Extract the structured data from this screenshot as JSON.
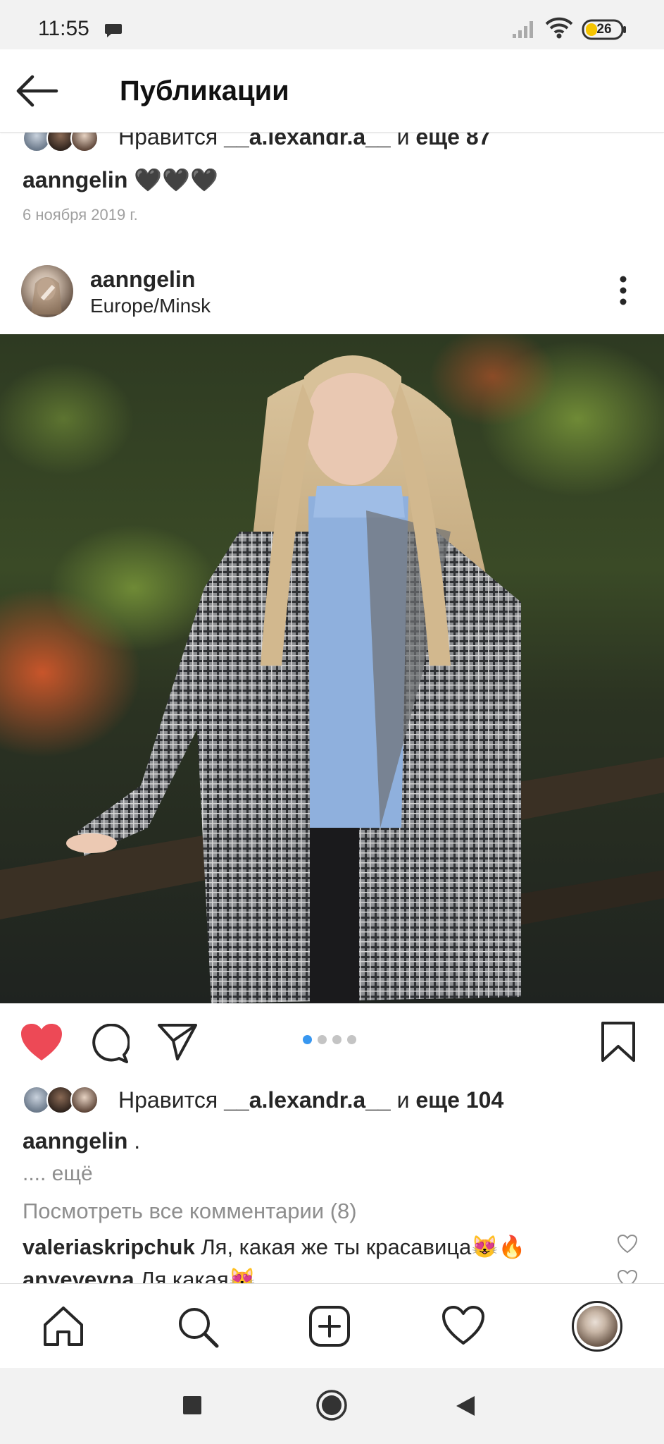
{
  "status_bar": {
    "time": "11:55",
    "battery": "26"
  },
  "header": {
    "title": "Публикации"
  },
  "previous_post": {
    "likes": {
      "prefix": "Нравится",
      "user": "__a.lexandr.a__",
      "middle": "и",
      "rest": "еще 87"
    },
    "caption": {
      "user": "aanngelin",
      "text": "🖤🖤🖤"
    },
    "date": "6 ноября 2019 г."
  },
  "post": {
    "username": "aanngelin",
    "location": "Europe/Minsk",
    "liked": true,
    "carousel": {
      "count": 4,
      "active": 1
    },
    "likes": {
      "prefix": "Нравится",
      "user": "__a.lexandr.a__",
      "middle": "и",
      "rest": "еще 104"
    },
    "caption": {
      "user": "aanngelin",
      "text": "."
    },
    "more": ".... ещё",
    "view_comments": "Посмотреть все комментарии (8)",
    "comments": [
      {
        "user": "valeriaskripchuk",
        "text": "Ля, какая же ты красавица😻🔥"
      },
      {
        "user": "anyeyeyna",
        "text": "Ля какая😻"
      }
    ]
  },
  "icons": {
    "back": "arrow-left-icon",
    "more": "three-dots-vertical-icon",
    "like": "heart-filled-icon",
    "comment": "speech-bubble-icon",
    "share": "paper-plane-icon",
    "save": "bookmark-icon",
    "nav": [
      "home-icon",
      "search-icon",
      "add-post-icon",
      "activity-heart-icon",
      "profile-avatar"
    ]
  },
  "colors": {
    "like_red": "#ed4956",
    "dot_active": "#3897f0",
    "text": "#262626",
    "muted": "#8e8e8e"
  }
}
